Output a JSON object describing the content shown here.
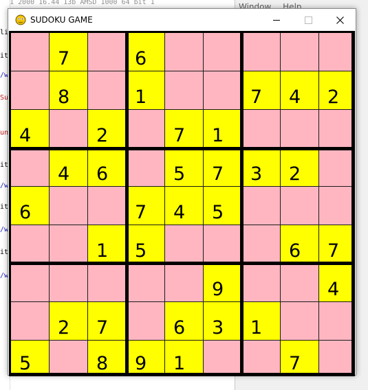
{
  "background": {
    "top_line": "1 2000   16.44 13b AMSD   1000 64 bit 1",
    "left_lines": [
      {
        "text": "li",
        "color": "#000000"
      },
      {
        "text": "it",
        "color": "#000000"
      },
      {
        "text": "/w",
        "color": "#1a1ac0"
      },
      {
        "text": "Su",
        "color": "#c01a1a"
      },
      {
        "text": "un",
        "color": "#c01a1a"
      },
      {
        "text": "it",
        "color": "#000000"
      },
      {
        "text": "/w",
        "color": "#1a1ac0"
      },
      {
        "text": "it",
        "color": "#000000"
      },
      {
        "text": "/w",
        "color": "#1a1ac0"
      },
      {
        "text": "it",
        "color": "#000000"
      },
      {
        "text": "/w",
        "color": "#1a1ac0"
      }
    ],
    "menu": [
      "Window",
      "Help"
    ]
  },
  "window": {
    "title": "SUDOKU GAME",
    "icon": "pygame-snake-icon",
    "buttons": [
      "minimize-icon",
      "maximize-icon",
      "close-icon"
    ]
  },
  "colors": {
    "given": "#ffff00",
    "empty": "#ffb6c1",
    "grid": "#000000"
  },
  "board": [
    [
      0,
      7,
      0,
      6,
      0,
      0,
      0,
      0,
      0
    ],
    [
      0,
      8,
      0,
      1,
      0,
      0,
      7,
      4,
      2
    ],
    [
      4,
      0,
      2,
      0,
      7,
      1,
      0,
      0,
      0
    ],
    [
      0,
      4,
      6,
      0,
      5,
      7,
      3,
      2,
      0
    ],
    [
      6,
      0,
      0,
      7,
      4,
      5,
      0,
      0,
      0
    ],
    [
      0,
      0,
      1,
      5,
      0,
      0,
      0,
      6,
      7
    ],
    [
      0,
      0,
      0,
      0,
      0,
      9,
      0,
      0,
      4
    ],
    [
      0,
      2,
      7,
      0,
      6,
      3,
      1,
      0,
      0
    ],
    [
      5,
      0,
      8,
      9,
      1,
      0,
      0,
      7,
      0
    ]
  ]
}
